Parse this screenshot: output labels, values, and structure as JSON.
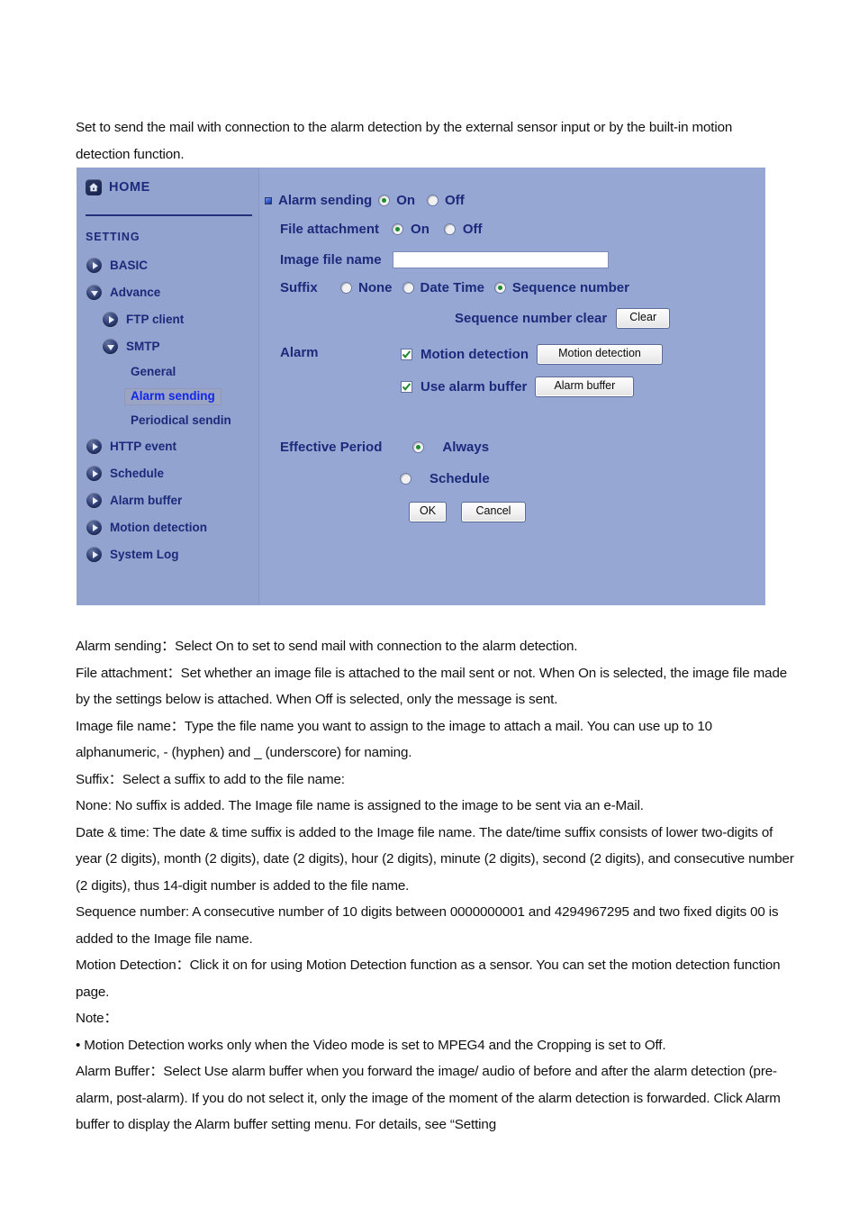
{
  "document": {
    "intro": "Set to send the mail with connection to the alarm detection by the external sensor input or by the built-in motion detection function.",
    "paragraphs": [
      "Alarm sending：Select On to set to send mail with connection to the alarm detection.",
      "File attachment：Set whether an image file is attached to the mail sent or not. When On is selected, the image file made by the settings below is attached. When Off is selected, only the message is sent.",
      "Image file name：Type the file name you want to assign to the image to attach a mail. You can use up to 10 alphanumeric, - (hyphen) and _ (underscore) for naming.",
      "Suffix：Select a suffix to add to the file name:",
      "None: No suffix is added. The Image file name is assigned to the image to be sent via an e-Mail.",
      "Date & time: The date & time suffix is added to the Image file name. The date/time suffix consists of lower two-digits of year (2 digits), month (2 digits), date (2 digits), hour (2 digits), minute (2 digits), second (2 digits), and consecutive number (2 digits), thus 14-digit number is added to the file name.",
      "Sequence number: A consecutive number of 10 digits between 0000000001 and 4294967295 and two fixed digits 00 is added to the Image file name.",
      "Motion Detection：Click it on for using Motion Detection function as a sensor. You can set the motion detection function page.",
      "Note：",
      "• Motion Detection works only when the Video mode is set to MPEG4 and the Cropping is set to Off.",
      "Alarm Buffer：Select Use alarm buffer when you forward the image/ audio of before and after the alarm detection (pre-alarm, post-alarm). If you do not select it, only the image of the moment of the alarm detection is forwarded. Click Alarm buffer to display the Alarm buffer setting menu. For details, see “Setting"
    ]
  },
  "camera_ui": {
    "sidebar": {
      "home_label": "HOME",
      "section_label": "SETTING",
      "items": [
        {
          "label": "BASIC",
          "level": 1,
          "icon": "triangle-right-icon",
          "selected": false
        },
        {
          "label": "Advance",
          "level": 1,
          "icon": "triangle-down-icon",
          "selected": false
        },
        {
          "label": "FTP client",
          "level": 2,
          "icon": "triangle-right-icon",
          "selected": false
        },
        {
          "label": "SMTP",
          "level": 2,
          "icon": "triangle-down-icon",
          "selected": false
        },
        {
          "label": "General",
          "level": 3,
          "icon": "none",
          "selected": false
        },
        {
          "label": "Alarm sending",
          "level": 3,
          "icon": "none",
          "selected": true
        },
        {
          "label": "Periodical sendin",
          "level": 3,
          "icon": "none",
          "selected": false
        },
        {
          "label": "HTTP event",
          "level": 1,
          "icon": "triangle-right-icon",
          "selected": false
        },
        {
          "label": "Schedule",
          "level": 1,
          "icon": "triangle-right-icon",
          "selected": false
        },
        {
          "label": "Alarm buffer",
          "level": 1,
          "icon": "triangle-right-icon",
          "selected": false
        },
        {
          "label": "Motion detection",
          "level": 1,
          "icon": "triangle-right-icon",
          "selected": false
        },
        {
          "label": "System Log",
          "level": 1,
          "icon": "triangle-right-icon",
          "selected": false
        }
      ]
    },
    "form": {
      "alarm_sending_label": "Alarm sending",
      "alarm_sending_on": "On",
      "alarm_sending_off": "Off",
      "file_attachment_label": "File attachment",
      "file_attachment_on": "On",
      "file_attachment_off": "Off",
      "image_file_name_label": "Image file name",
      "image_file_name_value": "",
      "suffix_label": "Suffix",
      "suffix_none": "None",
      "suffix_date_time": "Date Time",
      "suffix_sequence_number": "Sequence number",
      "sequence_clear_label": "Sequence number clear",
      "sequence_clear_button": "Clear",
      "alarm_label": "Alarm",
      "motion_detection_checkbox_label": "Motion detection",
      "motion_detection_button": "Motion detection",
      "use_alarm_buffer_label": "Use alarm buffer",
      "alarm_buffer_button": "Alarm buffer",
      "effective_period_label": "Effective Period",
      "effective_always": "Always",
      "effective_schedule": "Schedule",
      "ok_button": "OK",
      "cancel_button": "Cancel"
    },
    "colors": {
      "panel_bg": "#96a6d2",
      "sidebar_bg": "#93a3cf",
      "label_text": "#1b2a7a",
      "selected_text": "#1226ee",
      "selected_bg": "#9ba4c2",
      "check_green": "#1d8a2e"
    }
  }
}
